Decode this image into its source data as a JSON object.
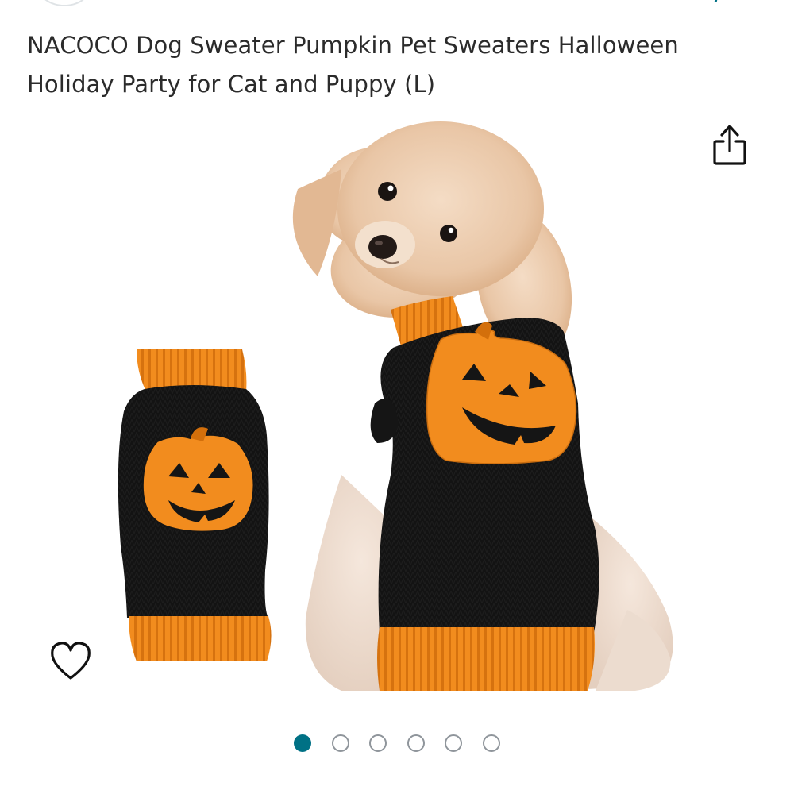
{
  "product": {
    "title": "NACOCO Dog Sweater Pumpkin Pet Sweaters Halloween Holiday Party for Cat and Puppy (L)"
  },
  "icons": {
    "share": "share-icon",
    "wishlist": "heart-outline-icon"
  },
  "carousel": {
    "dot_count": 6,
    "active_index": 0
  },
  "colors": {
    "accent": "#007185",
    "sweater_orange": "#f28c1e",
    "sweater_black": "#121212",
    "text": "#2b2b2b"
  }
}
